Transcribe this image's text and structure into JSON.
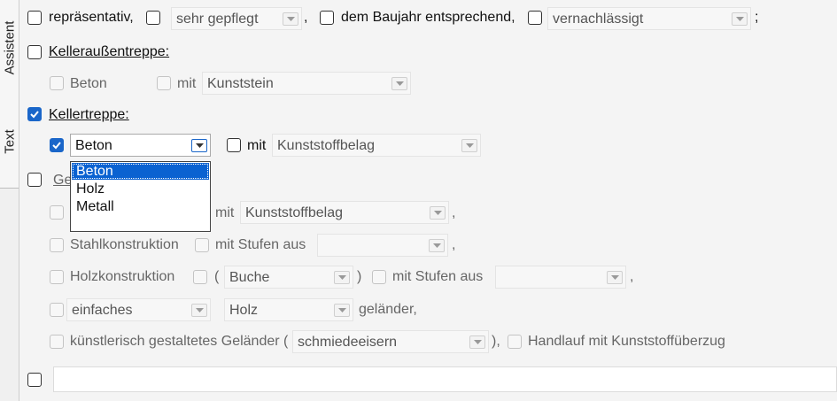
{
  "sidebar": {
    "tabs": [
      {
        "label": "Assistent"
      },
      {
        "label": "Text"
      }
    ]
  },
  "row1": {
    "representative": "repräsentativ,",
    "care_value": "sehr gepflegt",
    "sep1": ",",
    "year": "dem Baujahr entsprechend,",
    "neglect_value": "vernachlässigt",
    "sep2": ";"
  },
  "outer_stairs": {
    "heading": "Kelleraußentreppe:",
    "material": "Beton",
    "with": "mit",
    "surface_value": "Kunststein"
  },
  "cellar_stairs": {
    "heading": "Kellertreppe:",
    "material_value": "Beton",
    "with": "mit",
    "surface_value": "Kunststoffbelag",
    "dropdown_options": [
      "Beton",
      "Holz",
      "Metall"
    ]
  },
  "building_stairs": {
    "heading_partial": "Ge",
    "row1_with": "mit",
    "row1_surface_value": "Kunststoffbelag",
    "row1_sep": ",",
    "steel": "Stahlkonstruktion",
    "steel_steps": "mit Stufen aus",
    "steel_steps_value": "",
    "steel_sep": ",",
    "wood": "Holzkonstruktion",
    "paren_open": "(",
    "wood_type_value": "Buche",
    "paren_close": ")",
    "wood_steps": "mit Stufen aus",
    "wood_steps_value": "",
    "wood_sep": ",",
    "railing_type_value": "einfaches",
    "railing_material_value": "Holz",
    "railing_suffix": "geländer,",
    "artistic": "künstlerisch gestaltetes Geländer (",
    "artistic_value": "schmiedeeisern",
    "artistic_close": "),",
    "handrail": "Handlauf mit Kunststoffüberzug"
  },
  "free_text": {
    "value": ""
  }
}
